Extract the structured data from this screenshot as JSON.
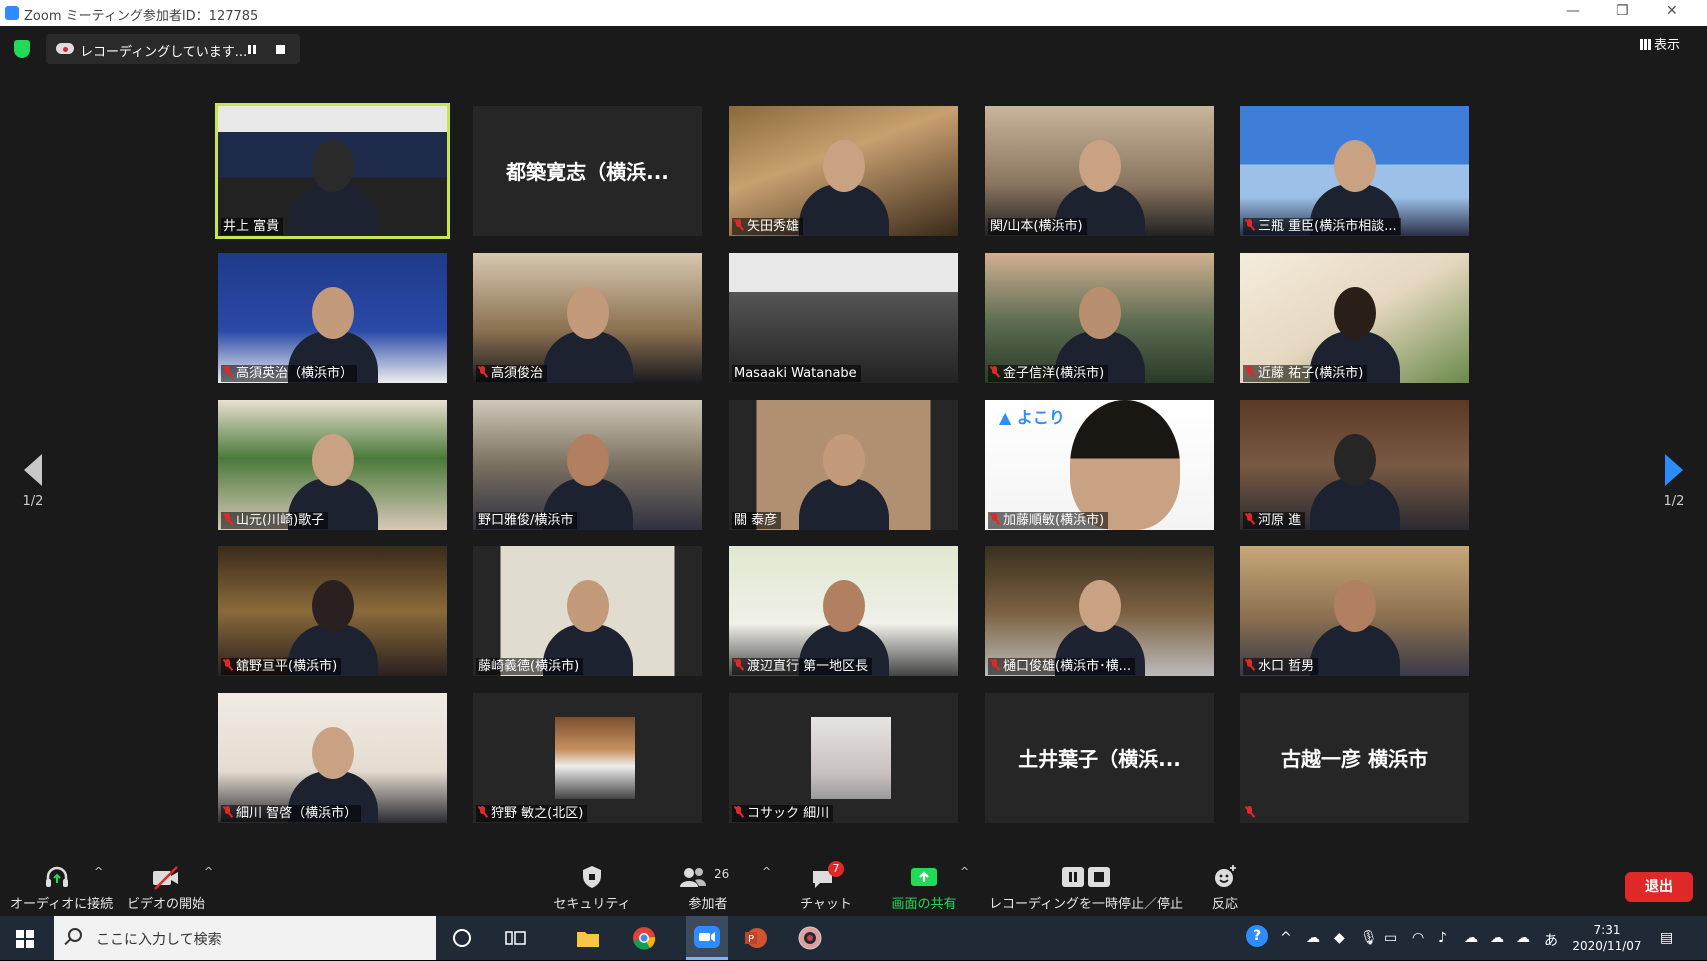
{
  "window": {
    "title": "Zoom ミーティング参加者ID：127785",
    "controls": [
      "—",
      "❐",
      "✕"
    ]
  },
  "recording": {
    "status": "レコーディングしています..."
  },
  "view_button": "表示",
  "page_indicator": {
    "left": "1/2",
    "right": "1/2"
  },
  "participants": [
    {
      "name": "井上 富貴",
      "muted": false,
      "video": true,
      "active": true
    },
    {
      "name": "",
      "muted": false,
      "video": false,
      "display": "都築寛志（横浜..."
    },
    {
      "name": "矢田秀雄",
      "muted": true,
      "video": true
    },
    {
      "name": "関/山本(横浜市)",
      "muted": false,
      "video": true
    },
    {
      "name": "三瓶 重臣(横浜市相談...",
      "muted": true,
      "video": true
    },
    {
      "name": "高須英治（横浜市）",
      "muted": true,
      "video": true
    },
    {
      "name": "高須俊治",
      "muted": true,
      "video": true
    },
    {
      "name": "Masaaki Watanabe",
      "muted": false,
      "video": true
    },
    {
      "name": "金子信洋(横浜市)",
      "muted": true,
      "video": true
    },
    {
      "name": "近藤 祐子(横浜市)",
      "muted": true,
      "video": true
    },
    {
      "name": "山元(川崎)歌子",
      "muted": true,
      "video": true
    },
    {
      "name": "野口雅俊/横浜市",
      "muted": false,
      "video": true
    },
    {
      "name": "關 泰彦",
      "muted": false,
      "video": true
    },
    {
      "name": "加藤順敏(横浜市)",
      "muted": true,
      "video": true,
      "logo_text": "よこり"
    },
    {
      "name": "河原 進",
      "muted": true,
      "video": true
    },
    {
      "name": "舘野亘平(横浜市)",
      "muted": true,
      "video": true
    },
    {
      "name": "藤崎義德(横浜市)",
      "muted": false,
      "video": true
    },
    {
      "name": "渡辺直行 第一地区長",
      "muted": true,
      "video": true
    },
    {
      "name": "樋口俊雄(横浜市･横...",
      "muted": true,
      "video": true
    },
    {
      "name": "水口 哲男",
      "muted": true,
      "video": true
    },
    {
      "name": "細川 智啓（横浜市）",
      "muted": true,
      "video": true
    },
    {
      "name": "狩野 敏之(北区)",
      "muted": true,
      "video": false,
      "thumb": true
    },
    {
      "name": "コサック 細川",
      "muted": true,
      "video": false,
      "thumb": true
    },
    {
      "name": "",
      "muted": false,
      "video": false,
      "display": "土井葉子（横浜..."
    },
    {
      "name": "",
      "muted": true,
      "video": false,
      "display": "古越一彦  横浜市"
    }
  ],
  "toolbar": {
    "audio": "オーディオに接続",
    "video": "ビデオの開始",
    "security": "セキュリティ",
    "participants": "参加者",
    "participants_count": "26",
    "chat": "チャット",
    "chat_badge": "7",
    "share": "画面の共有",
    "recording": "レコーディングを一時停止／停止",
    "reactions": "反応",
    "leave": "退出"
  },
  "taskbar": {
    "search_placeholder": "ここに入力して検索",
    "time": "7:31",
    "date": "2020/11/07",
    "ime": "あ"
  },
  "colors": {
    "accent": "#2d8cff",
    "share_green": "#23d959",
    "leave_red": "#e02828",
    "active_speaker": "#c8e650"
  }
}
